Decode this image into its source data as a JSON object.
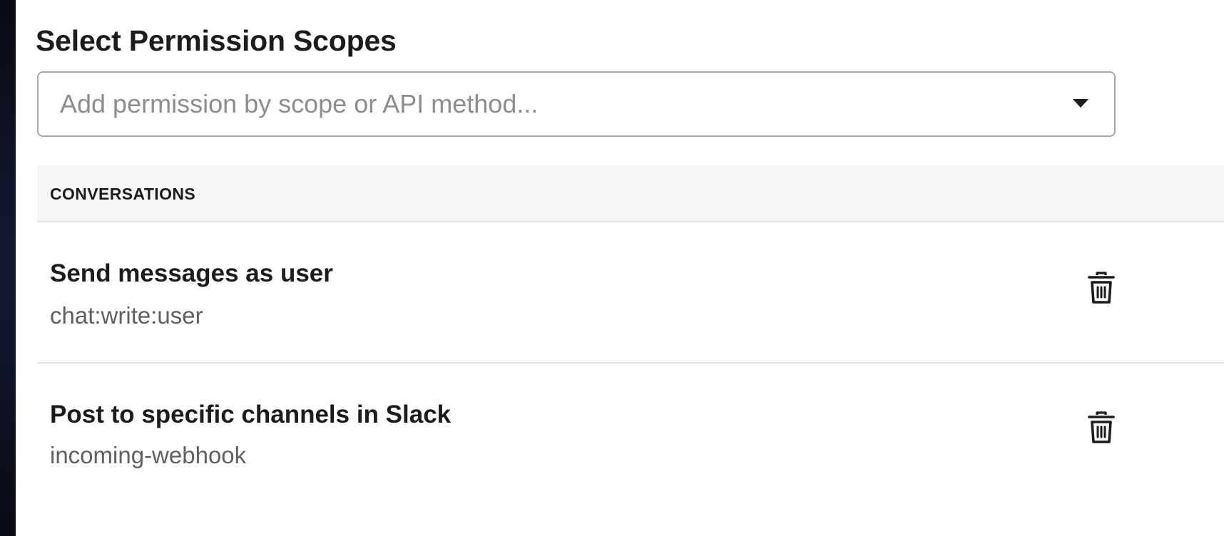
{
  "page": {
    "title": "Select Permission Scopes"
  },
  "scope_select": {
    "placeholder": "Add permission by scope or API method...",
    "icon": "caret-down-icon"
  },
  "sections": [
    {
      "label": "CONVERSATIONS",
      "scopes": [
        {
          "name": "Send messages as user",
          "scope": "chat:write:user",
          "action_icon": "trash-icon"
        },
        {
          "name": "Post to specific channels in Slack",
          "scope": "incoming-webhook",
          "action_icon": "trash-icon"
        }
      ]
    }
  ],
  "colors": {
    "title_text": "#1d1c1d",
    "secondary_text": "#616061",
    "placeholder_text": "#8d8c8e",
    "section_header_bg": "#f6f6f6",
    "divider": "#e2e2e2",
    "backdrop": "#0c0f1c"
  }
}
